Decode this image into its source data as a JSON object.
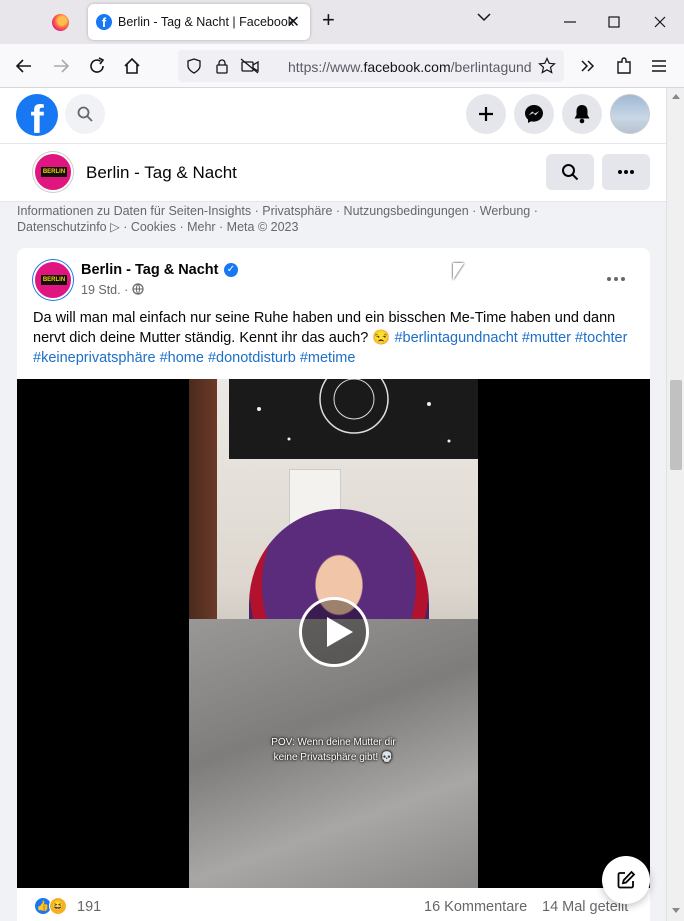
{
  "browser": {
    "tab_title": "Berlin - Tag & Nacht | Facebook",
    "tab_close": "✕",
    "new_tab": "+",
    "url_prefix": "https://www.",
    "url_domain": "facebook.com",
    "url_path": "/berlintagund"
  },
  "header": {
    "logo": "f"
  },
  "page": {
    "name": "Berlin - Tag & Nacht",
    "logo_text": "BERLIN"
  },
  "footer": {
    "links_line1": "Informationen zu Daten für Seiten-Insights · Privatsphäre · Nutzungsbedingungen · Werbung ·",
    "links_line2": "Datenschutzinfo ▷ · Cookies · Mehr · Meta © 2023"
  },
  "post": {
    "author": "Berlin - Tag & Nacht",
    "verified": "✓",
    "time": "19 Std. ·",
    "text": "Da will man mal einfach nur seine Ruhe haben und ein bisschen Me-Time haben und dann nervt dich deine Mutter ständig. Kennt ihr das auch? 😒 ",
    "hashtags": [
      "#berlintagundnacht",
      "#mutter",
      "#tochter",
      "#keineprivatsphäre",
      "#home",
      "#donotdisturb",
      "#metime"
    ],
    "video_caption_line1": "POV: Wenn deine Mutter dir",
    "video_caption_line2": "keine Privatsphäre gibt! 💀",
    "reaction_like": "👍",
    "reaction_haha": "😆",
    "reaction_count": "191",
    "comments": "16 Kommentare",
    "shares": "14 Mal geteilt"
  }
}
